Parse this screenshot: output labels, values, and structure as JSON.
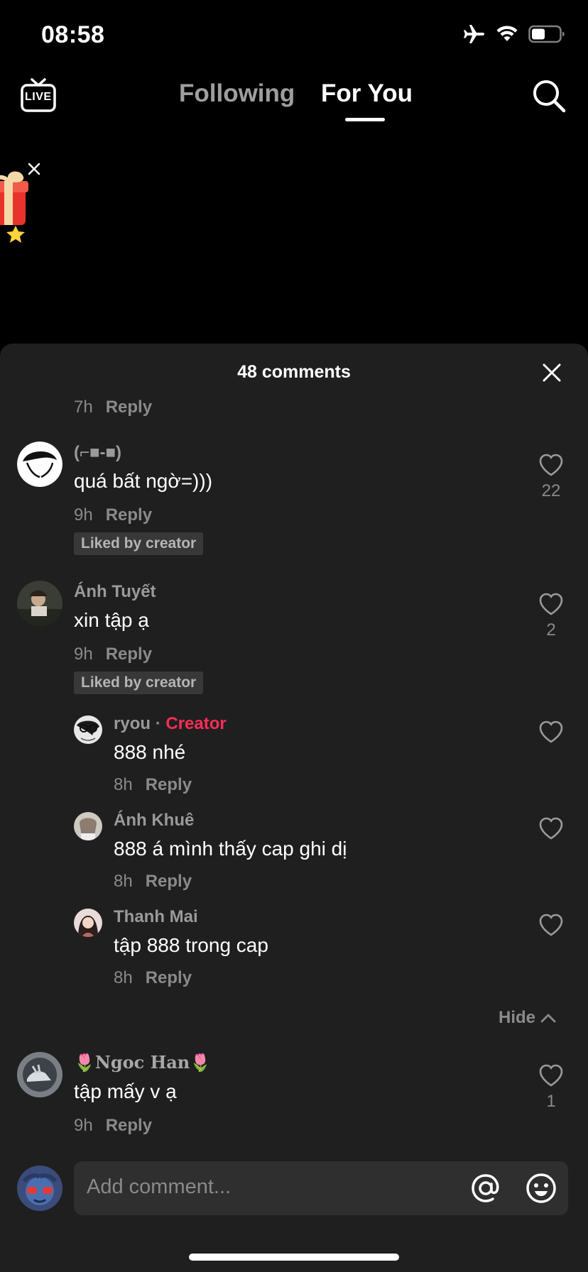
{
  "status_bar": {
    "time": "08:58"
  },
  "nav": {
    "live_label": "LIVE",
    "tabs": [
      {
        "label": "Following",
        "active": false
      },
      {
        "label": "For You",
        "active": true
      }
    ]
  },
  "comments_sheet": {
    "title": "48 comments",
    "top_partial": {
      "time": "7h",
      "reply": "Reply"
    },
    "comments": [
      {
        "username": "(⌐■-■)",
        "text": "quá bất ngờ=)))",
        "time": "9h",
        "reply": "Reply",
        "badge": "Liked by creator",
        "likes": "22"
      },
      {
        "username": "Ánh Tuyết",
        "text": "xin tập ạ",
        "time": "9h",
        "reply": "Reply",
        "badge": "Liked by creator",
        "likes": "2"
      },
      {
        "username": "🌷Ngoc Han🌷",
        "text": "tập mấy v ạ",
        "time": "9h",
        "reply": "Reply",
        "likes": "1"
      }
    ],
    "replies": [
      {
        "username": "ryou",
        "tag": "Creator",
        "text": "888 nhé",
        "time": "8h",
        "reply": "Reply"
      },
      {
        "username": "Ánh Khuê",
        "text": "888 á mình thấy cap ghi dị",
        "time": "8h",
        "reply": "Reply"
      },
      {
        "username": "Thanh Mai",
        "text": "tập 888 trong cap",
        "time": "8h",
        "reply": "Reply"
      }
    ],
    "hide_label": "Hide"
  },
  "composer": {
    "placeholder": "Add comment..."
  },
  "colors": {
    "creator": "#fe2c55",
    "sheet_bg": "#1f1f1f",
    "muted": "#8a8a8a"
  },
  "icons": [
    "airplane-icon",
    "wifi-icon",
    "battery-icon",
    "live-tv-icon",
    "search-icon",
    "close-icon",
    "heart-icon",
    "chevron-up-icon",
    "at-icon",
    "emoji-icon",
    "gift-icon"
  ]
}
